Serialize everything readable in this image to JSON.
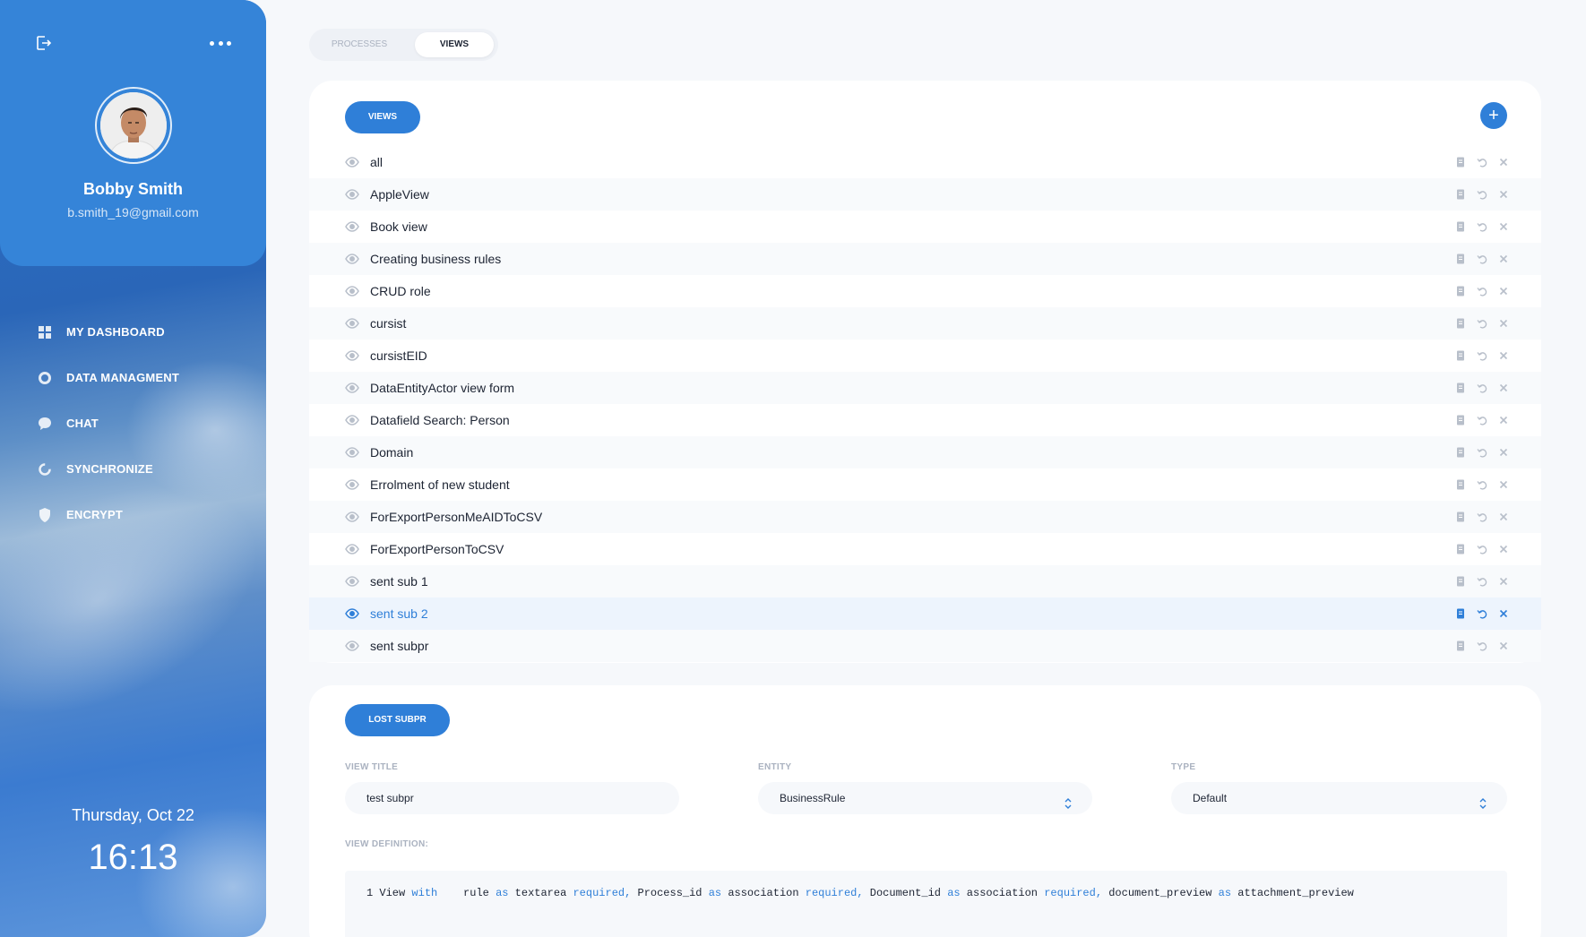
{
  "profile": {
    "name": "Bobby Smith",
    "email": "b.smith_19@gmail.com"
  },
  "nav": [
    {
      "label": "MY DASHBOARD",
      "icon": "grid-icon"
    },
    {
      "label": "DATA MANAGMENT",
      "icon": "donut-icon"
    },
    {
      "label": "CHAT",
      "icon": "chat-bubble-icon"
    },
    {
      "label": "SYNCHRONIZE",
      "icon": "sync-icon"
    },
    {
      "label": "ENCRYPT",
      "icon": "shield-icon"
    }
  ],
  "clock": {
    "date": "Thursday, Oct 22",
    "time": "16:13"
  },
  "tabs": {
    "processes": "PROCESSES",
    "views": "VIEWS",
    "active": "VIEWS"
  },
  "views_panel": {
    "button_label": "VIEWS",
    "add_label": "+",
    "selected": "sent sub 2",
    "rows": [
      "all",
      "AppleView",
      "Book view",
      "Creating business rules",
      "CRUD role",
      "cursist",
      "cursistEID",
      "DataEntityActor view form",
      "Datafield Search: Person",
      "Domain",
      "Errolment of new student",
      "ForExportPersonMeAIDToCSV",
      "ForExportPersonToCSV",
      "sent sub 1",
      "sent sub 2",
      "sent subpr"
    ]
  },
  "editor": {
    "button_label": "LOST SUBPR",
    "view_title_label": "VIEW TITLE",
    "view_title_value": "test subpr",
    "entity_label": "ENTITY",
    "entity_value": "BusinessRule",
    "type_label": "TYPE",
    "type_value": "Default",
    "definition_label": "VIEW DEFINITION:",
    "code": {
      "line_no": "1",
      "t1": "View",
      "k1": "with",
      "t2": "rule",
      "k2": "as",
      "t3": "textarea",
      "k3": "required,",
      "t4": "Process_id",
      "k4": "as",
      "t5": "association",
      "k5": "required,",
      "t6": "Document_id",
      "k6": "as",
      "t7": "association",
      "k7": "required,",
      "t8": "document_preview",
      "k8": "as",
      "t9": "attachment_preview"
    }
  },
  "colors": {
    "accent": "#2f7fd8",
    "sidebar": "#3584d8"
  }
}
